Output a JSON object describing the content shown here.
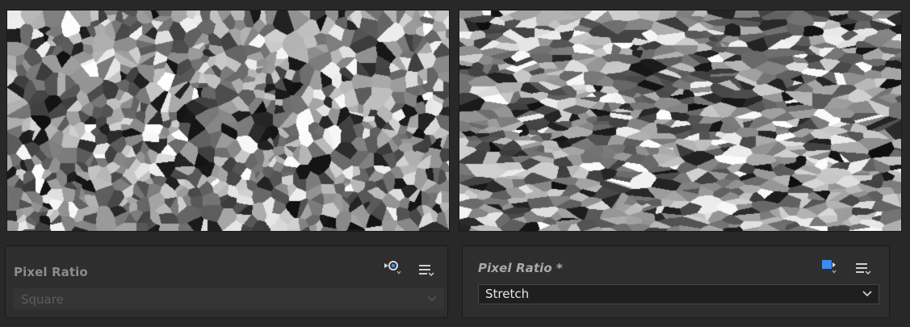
{
  "previews": {
    "left": {
      "mode": "square",
      "name": "Voronoi cell noise preview"
    },
    "right": {
      "mode": "stretch",
      "name": "Voronoi cell noise preview (stretched)"
    }
  },
  "left_panel": {
    "label": "Pixel Ratio",
    "value": "Square",
    "state": "disabled",
    "icons": [
      "inherit-link-icon",
      "menu-icon"
    ]
  },
  "right_panel": {
    "label": "Pixel Ratio *",
    "value": "Stretch",
    "state": "enabled",
    "icons": [
      "exposed-parameter-icon",
      "menu-icon"
    ]
  },
  "colors": {
    "background": "#282828",
    "panel": "#2e2e2e",
    "accent_blue": "#3a8cf0"
  }
}
